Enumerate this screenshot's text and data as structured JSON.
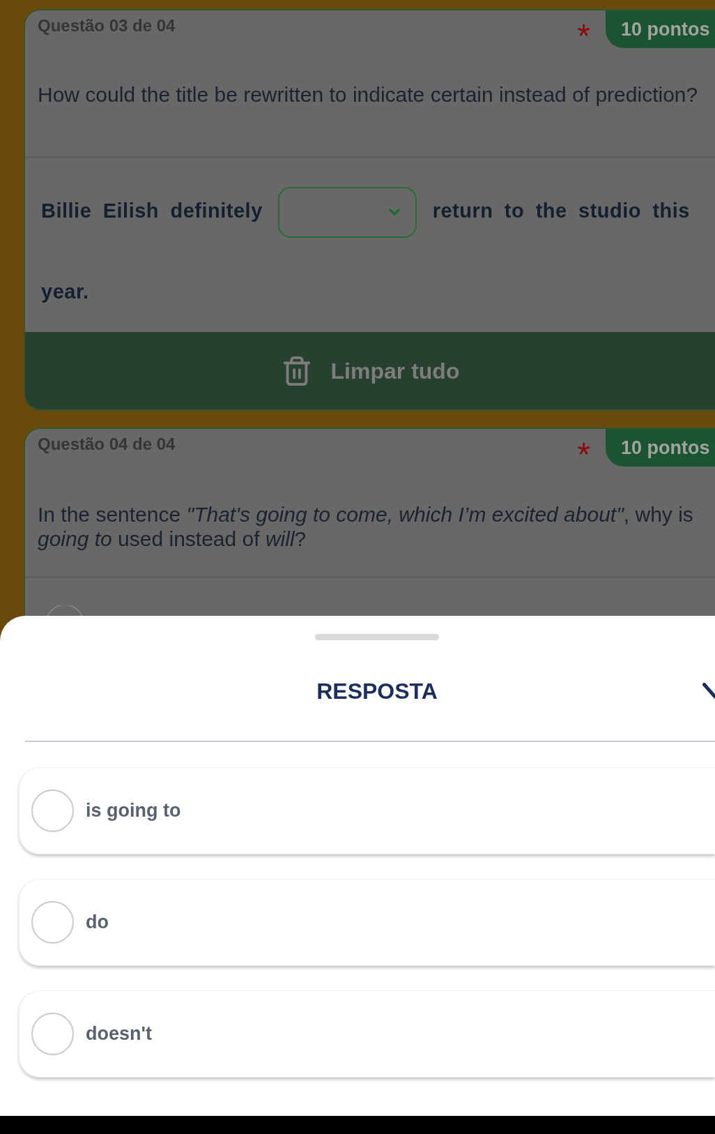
{
  "questions": [
    {
      "kind": "fill_blank",
      "header": "Questão 03 de 04",
      "required_mark": "*",
      "points": "10 pontos",
      "prompt": "How could the title be rewritten to indicate certain instead of prediction?",
      "sentence_lines": [
        [
          {
            "kind": "text",
            "text": "Billie Eilish definitely"
          },
          {
            "kind": "select"
          },
          {
            "kind": "text",
            "text": "return to the studio this"
          }
        ],
        [
          {
            "kind": "text",
            "text": "year."
          }
        ]
      ],
      "clear_button": "Limpar tudo"
    },
    {
      "kind": "multiple_choice",
      "header": "Questão 04 de 04",
      "required_mark": "*",
      "points": "10 pontos",
      "prompt": "In the sentence *\"That's going to come, which I’m excited about\"*, why is *going to* used instead of *will*?"
    }
  ],
  "answer_sheet": {
    "title": "RESPOSTA",
    "options": [
      {
        "label": "is going to",
        "selected": false
      },
      {
        "label": "do",
        "selected": false
      },
      {
        "label": "doesn't",
        "selected": false
      }
    ]
  }
}
